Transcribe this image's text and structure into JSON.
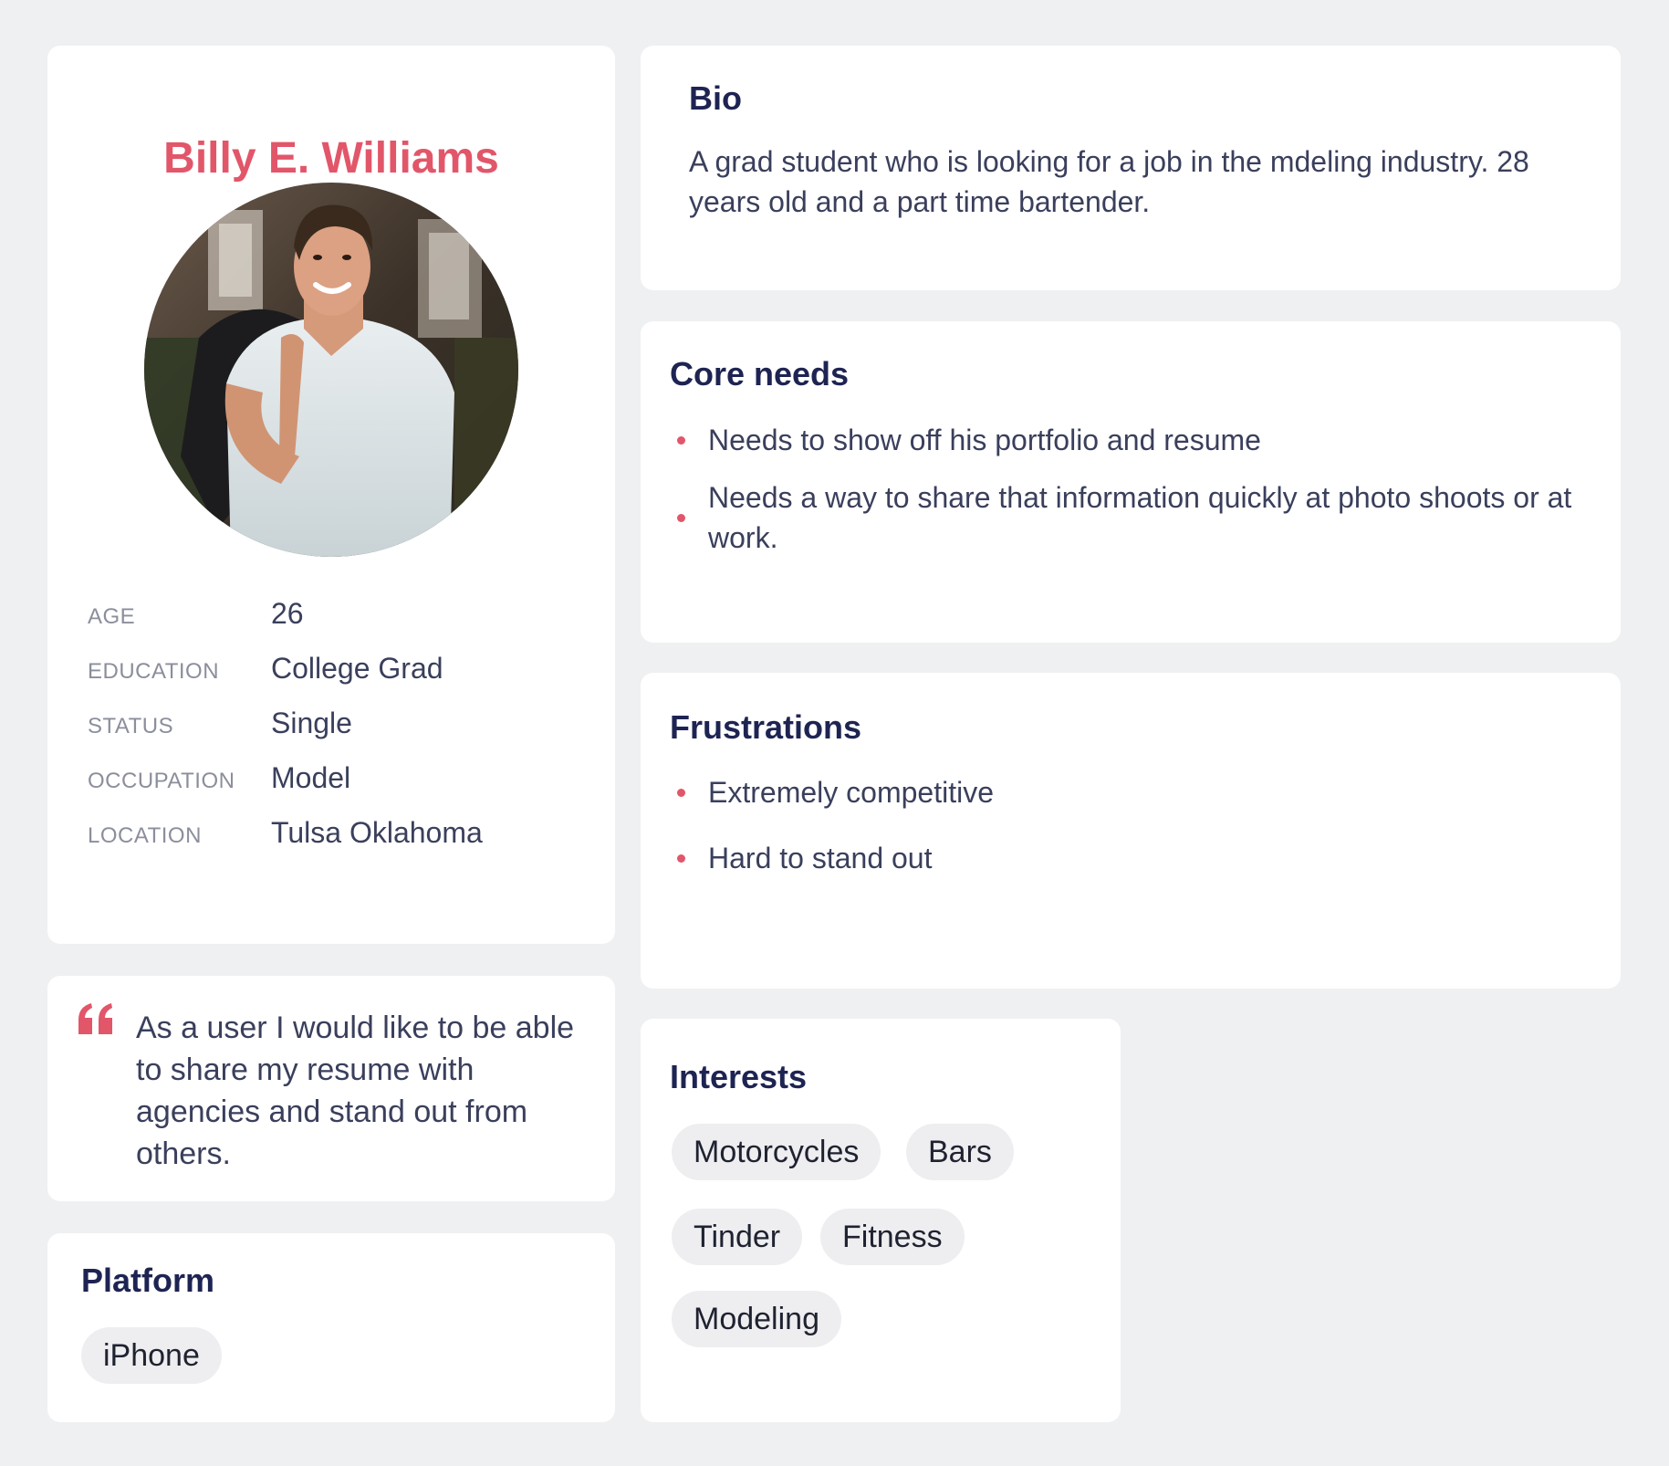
{
  "profile": {
    "name": "Billy E. Williams",
    "details": [
      {
        "label": "AGE",
        "value": "26"
      },
      {
        "label": "EDUCATION",
        "value": "College Grad"
      },
      {
        "label": "STATUS",
        "value": "Single"
      },
      {
        "label": "OCCUPATION",
        "value": "Model"
      },
      {
        "label": "LOCATION",
        "value": "Tulsa Oklahoma"
      }
    ]
  },
  "quote": {
    "text": "As a user I would like to be able to share my resume with agencies and stand out from others."
  },
  "platform": {
    "title": "Platform",
    "items": [
      "iPhone"
    ]
  },
  "bio": {
    "title": "Bio",
    "text": "A grad student who is looking for a job in the mdeling industry. 28 years old and a part time bartender."
  },
  "core_needs": {
    "title": "Core needs",
    "items": [
      "Needs to show off his portfolio and resume",
      "Needs a way to share that information quickly at photo shoots or at work."
    ]
  },
  "frustrations": {
    "title": "Frustrations",
    "items": [
      "Extremely competitive",
      "Hard to stand out"
    ]
  },
  "interests": {
    "title": "Interests",
    "items": [
      "Motorcycles",
      "Bars",
      "Tinder",
      "Fitness",
      "Modeling"
    ]
  },
  "colors": {
    "accent": "#e2566a",
    "heading": "#1e2452",
    "body_text": "#3a3f5c",
    "background": "#eff0f2",
    "chip": "#eeeef0"
  }
}
